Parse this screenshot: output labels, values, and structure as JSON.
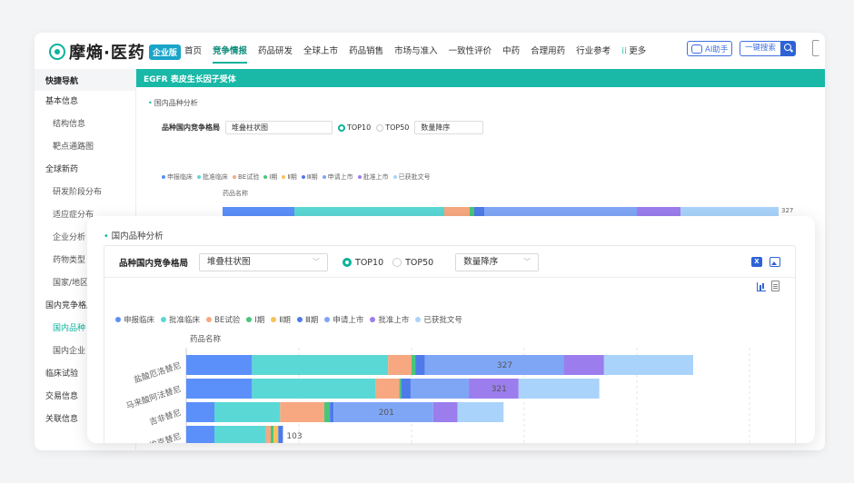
{
  "app": {
    "logo_text": "摩熵·医药",
    "logo_badge": "企业版",
    "nav": [
      "首页",
      "竞争情报",
      "药品研发",
      "全球上市",
      "药品销售",
      "市场与准入",
      "一致性评价",
      "中药",
      "合理用药",
      "行业参考"
    ],
    "nav_active_index": 1,
    "nav_more": "更多",
    "ai_button": "AI助手",
    "search_button": "一键搜索"
  },
  "sidebar": {
    "header": "快捷导航",
    "items": [
      {
        "label": "基本信息",
        "level": 1,
        "active": false
      },
      {
        "label": "结构信息",
        "level": 2,
        "active": false
      },
      {
        "label": "靶点通路图",
        "level": 2,
        "active": false
      },
      {
        "label": "全球新药",
        "level": 1,
        "active": false
      },
      {
        "label": "研发阶段分布",
        "level": 2,
        "active": false
      },
      {
        "label": "适应症分布",
        "level": 2,
        "active": false
      },
      {
        "label": "企业分析",
        "level": 2,
        "active": false
      },
      {
        "label": "药物类型",
        "level": 2,
        "active": false
      },
      {
        "label": "国家/地区",
        "level": 2,
        "active": false
      },
      {
        "label": "国内竞争格局",
        "level": 1,
        "active": false
      },
      {
        "label": "国内品种",
        "level": 2,
        "active": true
      },
      {
        "label": "国内企业",
        "level": 2,
        "active": false
      },
      {
        "label": "临床试验",
        "level": 1,
        "active": false
      },
      {
        "label": "交易信息",
        "level": 1,
        "active": false
      },
      {
        "label": "关联信息",
        "level": 1,
        "active": false
      }
    ]
  },
  "content_header": "EGFR 表皮生长因子受体",
  "section_title": "国内品种分析",
  "controls": {
    "label": "品种国内竞争格局",
    "chart_type": "堆叠柱状图",
    "radio_top10": "TOP10",
    "radio_top50": "TOP50",
    "radio_selected": "TOP10",
    "sort": "数量降序"
  },
  "colors": {
    "accent": "#19b8a7",
    "link": "#2e63d6"
  },
  "chart_data": {
    "type": "bar",
    "orientation": "horizontal",
    "stacked": true,
    "ylabel": "药品名称",
    "categories": [
      "盐酸厄洛替尼",
      "马来酸阿法替尼",
      "吉非替尼",
      "埃克替尼"
    ],
    "totals": [
      327,
      321,
      201,
      103
    ],
    "series": [
      {
        "name": "申报临床",
        "color": "#5b8ff9",
        "values": [
          70,
          70,
          30,
          30
        ]
      },
      {
        "name": "批准临床",
        "color": "#5ad8d6",
        "values": [
          145,
          132,
          70,
          55
        ]
      },
      {
        "name": "BE试验",
        "color": "#f7a880",
        "values": [
          25,
          25,
          47,
          5
        ]
      },
      {
        "name": "Ⅰ期",
        "color": "#49c67a",
        "values": [
          4,
          2,
          6,
          3
        ]
      },
      {
        "name": "Ⅱ期",
        "color": "#f7c259",
        "values": [
          0,
          0,
          0,
          5
        ]
      },
      {
        "name": "Ⅲ期",
        "color": "#4e7be8",
        "values": [
          10,
          10,
          4,
          5
        ]
      },
      {
        "name": "申请上市",
        "color": "#7fa6f5",
        "values": [
          148,
          62,
          106,
          0
        ]
      },
      {
        "name": "批准上市",
        "color": "#9b7ded",
        "values": [
          43,
          53,
          26,
          0
        ]
      },
      {
        "name": "已获批文号",
        "color": "#a9d3fb",
        "values": [
          95,
          86,
          49,
          0
        ]
      }
    ],
    "xlim": [
      0,
      600
    ],
    "grid": true,
    "legend": "top-left"
  }
}
